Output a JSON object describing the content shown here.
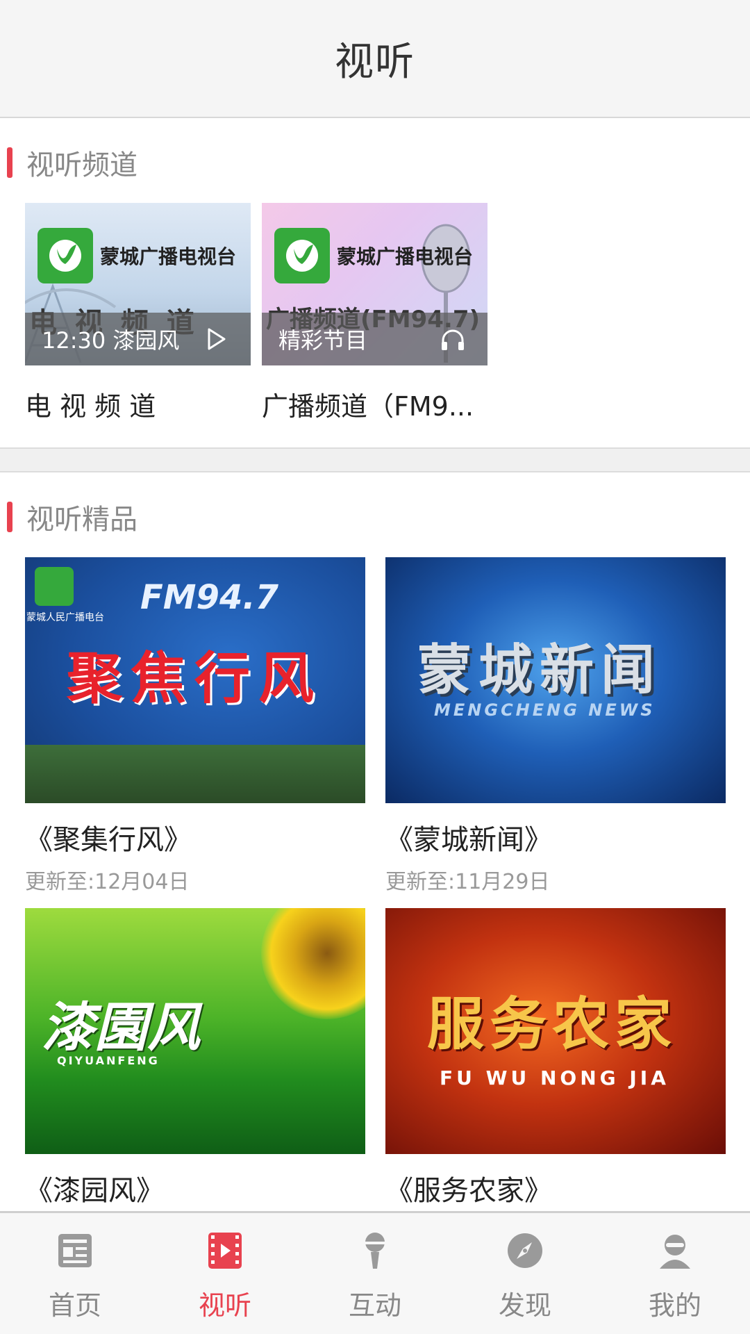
{
  "header": {
    "title": "视听"
  },
  "channels_section": {
    "title": "视听频道",
    "items": [
      {
        "logo_text": "蒙城广播电视台",
        "overlay_text": "12:30  漆园风",
        "overlay_icon": "play-icon",
        "big_name": "电 视 频 道",
        "name": "电 视 频 道"
      },
      {
        "logo_text": "蒙城广播电视台",
        "overlay_text": "精彩节目",
        "overlay_icon": "headphones-icon",
        "big_name": "广播频道(FM94.7)",
        "name": "广播频道（FM9..."
      }
    ]
  },
  "programs_section": {
    "title": "视听精品",
    "items": [
      {
        "title": "《聚集行风》",
        "updated": "更新至:12月04日",
        "art_main": "聚焦行风",
        "art_top": "FM94.7",
        "art_small": "蒙城人民广播电台"
      },
      {
        "title": "《蒙城新闻》",
        "updated": "更新至:11月29日",
        "art_main": "蒙城新闻",
        "art_sub": "MENGCHENG  NEWS"
      },
      {
        "title": "《漆园风》",
        "updated": "",
        "art_main": "漆園风",
        "art_sub": "QIYUANFENG"
      },
      {
        "title": "《服务农家》",
        "updated": "",
        "art_main": "服务农家",
        "art_sub": "FU WU NONG JIA"
      }
    ]
  },
  "tabbar": {
    "tabs": [
      {
        "label": "首页",
        "icon": "news-icon",
        "active": false
      },
      {
        "label": "视听",
        "icon": "video-icon",
        "active": true
      },
      {
        "label": "互动",
        "icon": "microphone-icon",
        "active": false
      },
      {
        "label": "发现",
        "icon": "compass-icon",
        "active": false
      },
      {
        "label": "我的",
        "icon": "user-icon",
        "active": false
      }
    ]
  },
  "colors": {
    "accent": "#e8424f",
    "inactive": "#888888",
    "logo_green": "#35a93c"
  }
}
